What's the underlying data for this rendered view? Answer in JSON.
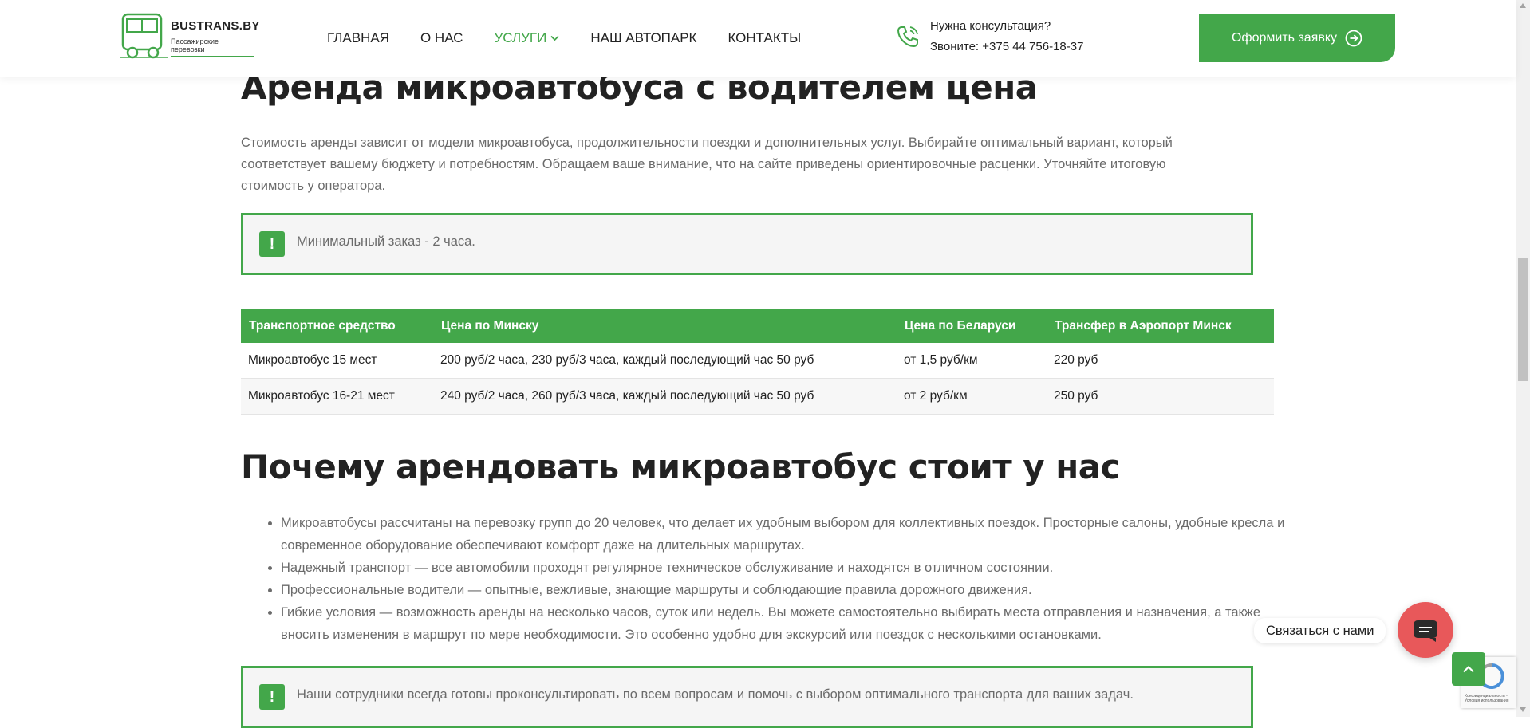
{
  "header": {
    "logo_name": "BUSTRANS.BY",
    "logo_sub": "Пассажирские перевозки",
    "nav": [
      "ГЛАВНАЯ",
      "О НАС",
      "УСЛУГИ",
      "НАШ АВТОПАРК",
      "КОНТАКТЫ"
    ],
    "consult_question": "Нужна консультация?",
    "consult_phone": "Звоните: +375 44 756-18-37",
    "cta_label": "Оформить заявку"
  },
  "section1": {
    "title": "Аренда микроавтобуса с водителем цена",
    "paragraph": "Стоимость аренды зависит от модели микроавтобуса, продолжительности поездки и дополнительных услуг. Выбирайте оптимальный вариант, который соответствует вашему бюджету и потребностям. Обращаем ваше внимание, что на сайте приведены ориентировочные расценки. Уточняйте итоговую стоимость у оператора.",
    "notice": "Минимальный заказ - 2 часа."
  },
  "price_table": {
    "headers": [
      "Транспортное средство",
      "Цена по Минску",
      "Цена по Беларуси",
      "Трансфер в Аэропорт Минск"
    ],
    "rows": [
      [
        "Микроавтобус 15 мест",
        "200 руб/2 часа, 230 руб/3 часа, каждый последующий час 50 руб",
        "от 1,5 руб/км",
        "220 руб"
      ],
      [
        "Микроавтобус 16-21 мест",
        "240 руб/2 часа, 260 руб/3 часа, каждый последующий час 50 руб",
        "от 2 руб/км",
        "250 руб"
      ]
    ]
  },
  "section2": {
    "title": "Почему арендовать микроавтобус стоит у нас",
    "bullets": [
      "Микроавтобусы рассчитаны на перевозку групп до 20 человек, что делает их удобным выбором для коллективных поездок. Просторные салоны, удобные кресла и современное оборудование обеспечивают комфорт даже на длительных маршрутах.",
      "Надежный транспорт — все автомобили проходят регулярное техническое обслуживание и находятся в отличном состоянии.",
      "Профессиональные водители — опытные, вежливые, знающие маршруты и соблюдающие правила дорожного движения.",
      "Гибкие условия — возможность аренды на несколько часов, суток или недель. Вы можете самостоятельно выбирать места отправления и назначения, а также вносить изменения в маршрут по мере необходимости. Это особенно удобно для экскурсий или поездок с несколькими остановками."
    ],
    "notice": "Наши сотрудники всегда готовы проконсультировать по всем вопросам и помочь с выбором оптимального транспорта для ваших задач."
  },
  "widgets": {
    "contact_label": "Связаться с нами",
    "recaptcha_text": [
      "Конфиденциальность -",
      "Условия использования"
    ]
  },
  "colors": {
    "accent": "#43a74a",
    "contact_button": "#e8585a",
    "text_muted": "#6b6b6b"
  },
  "icons": [
    "bus-logo-icon",
    "chevron-down-icon",
    "phone-icon",
    "arrow-right-circle-icon",
    "exclamation-icon",
    "chat-icon",
    "arrow-up-icon",
    "recaptcha-icon"
  ]
}
